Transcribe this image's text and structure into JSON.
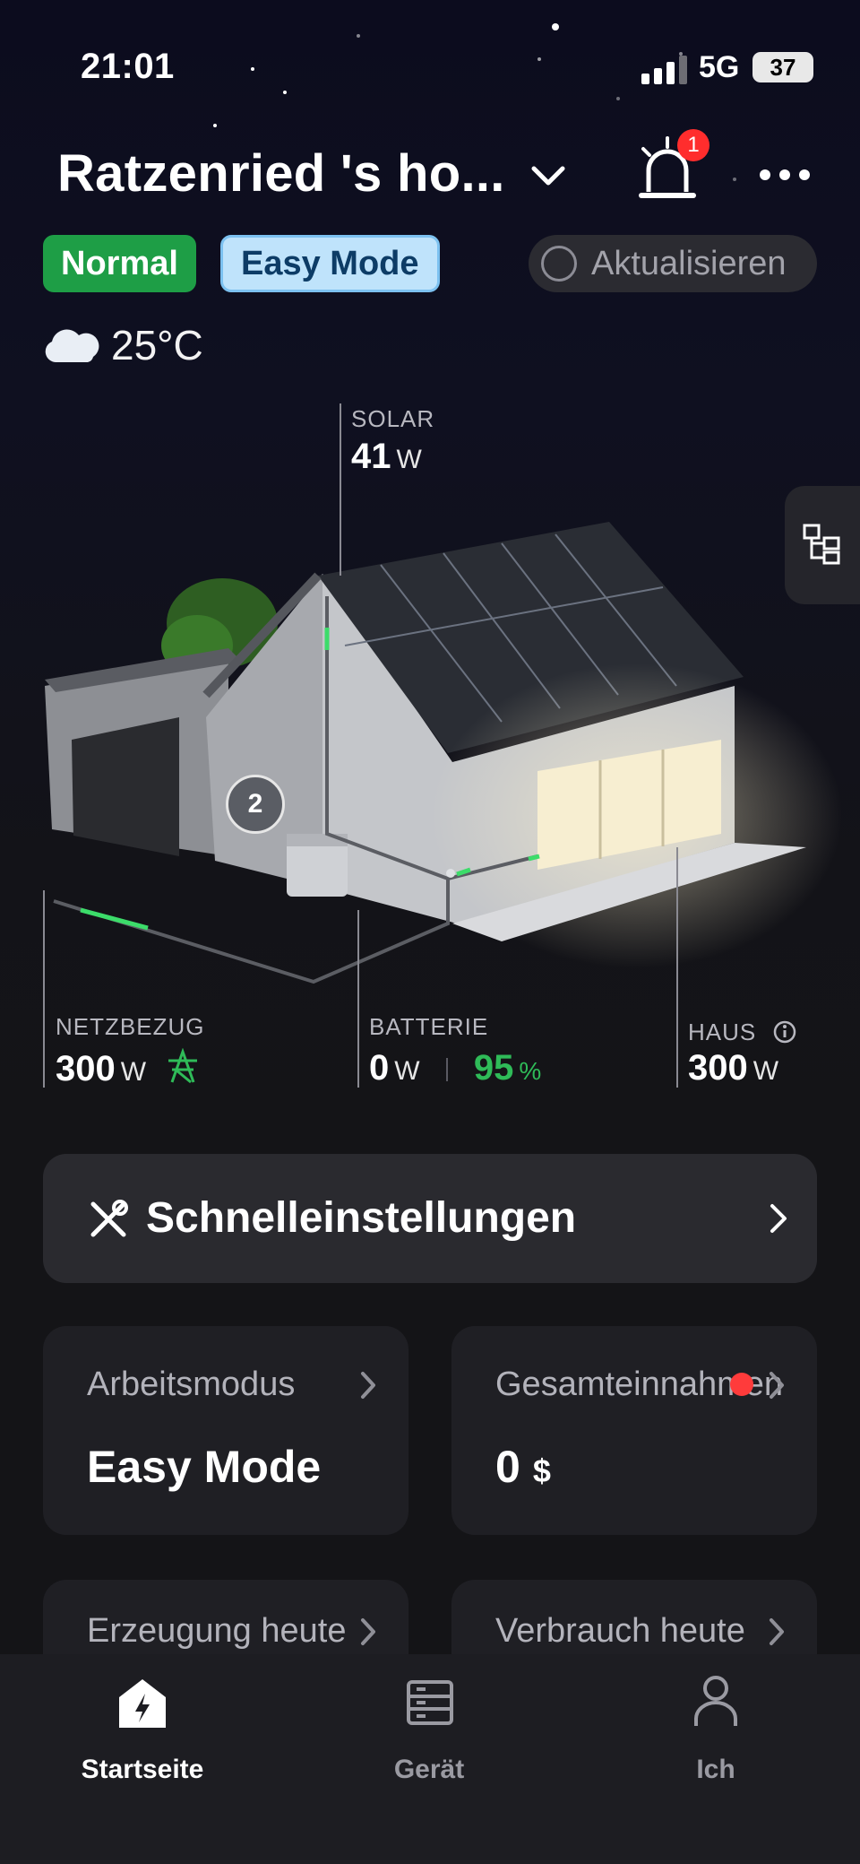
{
  "status_bar": {
    "time": "21:01",
    "network": "5G",
    "battery": "37"
  },
  "header": {
    "home_name": "Ratzenried 's ho...",
    "alarm_count": "1",
    "status_badge": "Normal",
    "mode_badge": "Easy Mode",
    "refresh_label": "Aktualisieren"
  },
  "weather": {
    "temperature": "25°C",
    "icon": "cloud-icon"
  },
  "energy_flow": {
    "solar": {
      "label": "SOLAR",
      "value": "41",
      "unit": "W"
    },
    "grid": {
      "label": "NETZBEZUG",
      "value": "300",
      "unit": "W"
    },
    "battery": {
      "label": "BATTERIE",
      "value": "0",
      "unit": "W",
      "soc": "95",
      "soc_unit": "%"
    },
    "house": {
      "label": "HAUS",
      "value": "300",
      "unit": "W"
    },
    "device_count": "2"
  },
  "quick_settings": {
    "label": "Schnelleinstellungen"
  },
  "cards": {
    "work_mode": {
      "title": "Arbeitsmodus",
      "value": "Easy Mode"
    },
    "total_income": {
      "title": "Gesamteinnahmen",
      "value": "0",
      "unit": "$"
    },
    "generation_today": {
      "title": "Erzeugung heute"
    },
    "consumption_today": {
      "title": "Verbrauch heute"
    }
  },
  "nav": {
    "home": "Startseite",
    "device": "Gerät",
    "me": "Ich"
  },
  "colors": {
    "accent_green": "#1e9e46",
    "easy_mode_bg": "#bfe3fb",
    "battery_soc_green": "#2fbb58",
    "alarm_red": "#ff2d2d"
  }
}
